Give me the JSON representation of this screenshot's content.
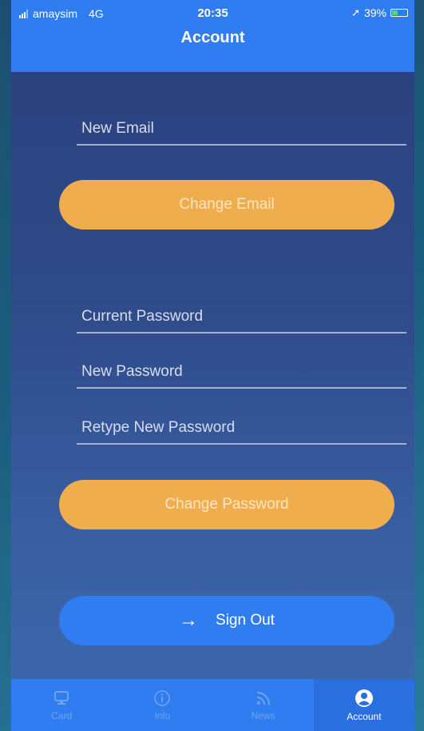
{
  "status_bar": {
    "carrier": "amaysim",
    "network": "4G",
    "time": "20:35",
    "battery": "39%",
    "battery_fraction": 0.39
  },
  "nav": {
    "title": "Account"
  },
  "email_section": {
    "new_email_placeholder": "New Email",
    "change_email_label": "Change Email"
  },
  "password_section": {
    "current_password_placeholder": "Current Password",
    "new_password_placeholder": "New Password",
    "retype_password_placeholder": "Retype New Password",
    "change_password_label": "Change Password"
  },
  "sign_out": {
    "label": "Sign Out",
    "icon": "arrow-right-icon"
  },
  "tab_bar": {
    "items": [
      {
        "label": "Card",
        "icon": "card-icon",
        "active": false
      },
      {
        "label": "Info",
        "icon": "info-icon",
        "active": false
      },
      {
        "label": "News",
        "icon": "rss-icon",
        "active": false
      },
      {
        "label": "Account",
        "icon": "user-circle-icon",
        "active": true
      }
    ]
  },
  "colors": {
    "primary_blue": "#2f7df0",
    "button_orange": "#f0ad4e",
    "background": "#2e4a88"
  }
}
